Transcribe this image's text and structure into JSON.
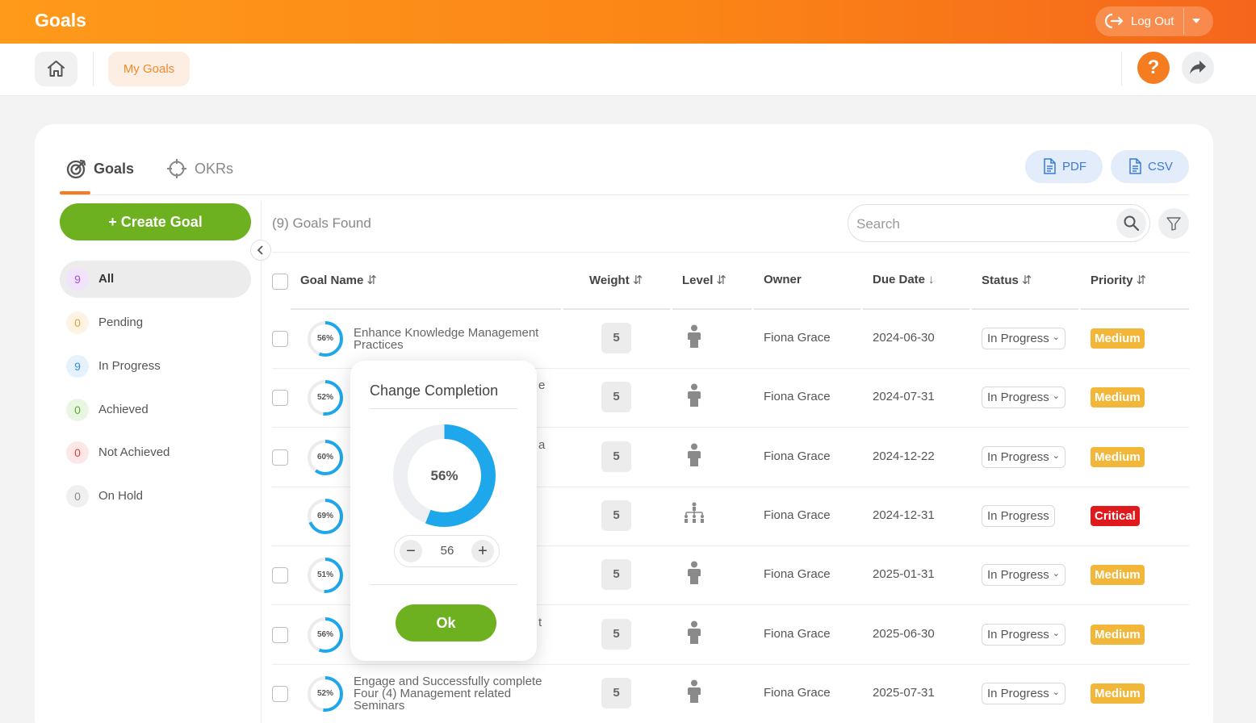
{
  "app": {
    "title": "Goals",
    "logout_label": "Log Out"
  },
  "subnav": {
    "home_icon": "home-icon",
    "my_goals_label": "My Goals",
    "help_label": "?",
    "share_icon": "share-icon"
  },
  "tabs": [
    {
      "label": "Goals",
      "icon": "target-icon",
      "active": true
    },
    {
      "label": "OKRs",
      "icon": "crosshair-icon",
      "active": false
    }
  ],
  "export": {
    "pdf_label": "PDF",
    "csv_label": "CSV"
  },
  "sidebar": {
    "create_label": "+ Create Goal",
    "filters": [
      {
        "count": "9",
        "label": "All",
        "color": "#a64fd6",
        "bg": "#f1e4fa",
        "active": true
      },
      {
        "count": "0",
        "label": "Pending",
        "color": "#f59a2e",
        "bg": "#fff3e4",
        "active": false
      },
      {
        "count": "9",
        "label": "In Progress",
        "color": "#2f8de4",
        "bg": "#e5f1fc",
        "active": false
      },
      {
        "count": "0",
        "label": "Achieved",
        "color": "#5aae2c",
        "bg": "#e9f6e2",
        "active": false
      },
      {
        "count": "0",
        "label": "Not Achieved",
        "color": "#e23b3b",
        "bg": "#fde7e7",
        "active": false
      },
      {
        "count": "0",
        "label": "On Hold",
        "color": "#8a8a8a",
        "bg": "#f0f0f0",
        "active": false
      }
    ]
  },
  "table": {
    "found_label": "(9) Goals Found",
    "search_placeholder": "Search",
    "columns": {
      "goal_name": "Goal Name",
      "weight": "Weight",
      "level": "Level",
      "owner": "Owner",
      "due_date": "Due Date",
      "status": "Status",
      "priority": "Priority"
    },
    "rows": [
      {
        "progress": 56,
        "pct": "56%",
        "name": "Enhance Knowledge Management Practices",
        "name_visible": "Enhance Knowledge Management Practices",
        "weight": "5",
        "level": "individual",
        "owner": "Fiona Grace",
        "due": "2024-06-30",
        "status": "In Progress",
        "status_dropdown": true,
        "priority": "Medium",
        "checkbox": true
      },
      {
        "progress": 52,
        "pct": "52%",
        "name": "e",
        "weight": "5",
        "level": "individual",
        "owner": "Fiona Grace",
        "due": "2024-07-31",
        "status": "In Progress",
        "status_dropdown": true,
        "priority": "Medium",
        "checkbox": true
      },
      {
        "progress": 60,
        "pct": "60%",
        "name": "a",
        "weight": "5",
        "level": "individual",
        "owner": "Fiona Grace",
        "due": "2024-12-22",
        "status": "In Progress",
        "status_dropdown": true,
        "priority": "Medium",
        "checkbox": true
      },
      {
        "progress": 69,
        "pct": "69%",
        "name": "",
        "weight": "5",
        "level": "organization",
        "owner": "Fiona Grace",
        "due": "2024-12-31",
        "status": "In Progress",
        "status_dropdown": false,
        "priority": "Critical",
        "checkbox": false
      },
      {
        "progress": 51,
        "pct": "51%",
        "name": "",
        "weight": "5",
        "level": "individual",
        "owner": "Fiona Grace",
        "due": "2025-01-31",
        "status": "In Progress",
        "status_dropdown": true,
        "priority": "Medium",
        "checkbox": true
      },
      {
        "progress": 56,
        "pct": "56%",
        "name": "t",
        "weight": "5",
        "level": "individual",
        "owner": "Fiona Grace",
        "due": "2025-06-30",
        "status": "In Progress",
        "status_dropdown": true,
        "priority": "Medium",
        "checkbox": true
      },
      {
        "progress": 52,
        "pct": "52%",
        "name": "Engage and Successfully complete Four (4) Management related Seminars",
        "weight": "5",
        "level": "individual",
        "owner": "Fiona Grace",
        "due": "2025-07-31",
        "status": "In Progress",
        "status_dropdown": true,
        "priority": "Medium",
        "checkbox": true
      }
    ]
  },
  "popup": {
    "title": "Change Completion",
    "value": 56,
    "value_label": "56%",
    "stepper_value": "56",
    "ok_label": "Ok"
  },
  "colors": {
    "accent": "#f57c1f",
    "green": "#6db120",
    "ring": "#1ea7ea",
    "medium": "#f2b739",
    "critical": "#e0191c"
  }
}
